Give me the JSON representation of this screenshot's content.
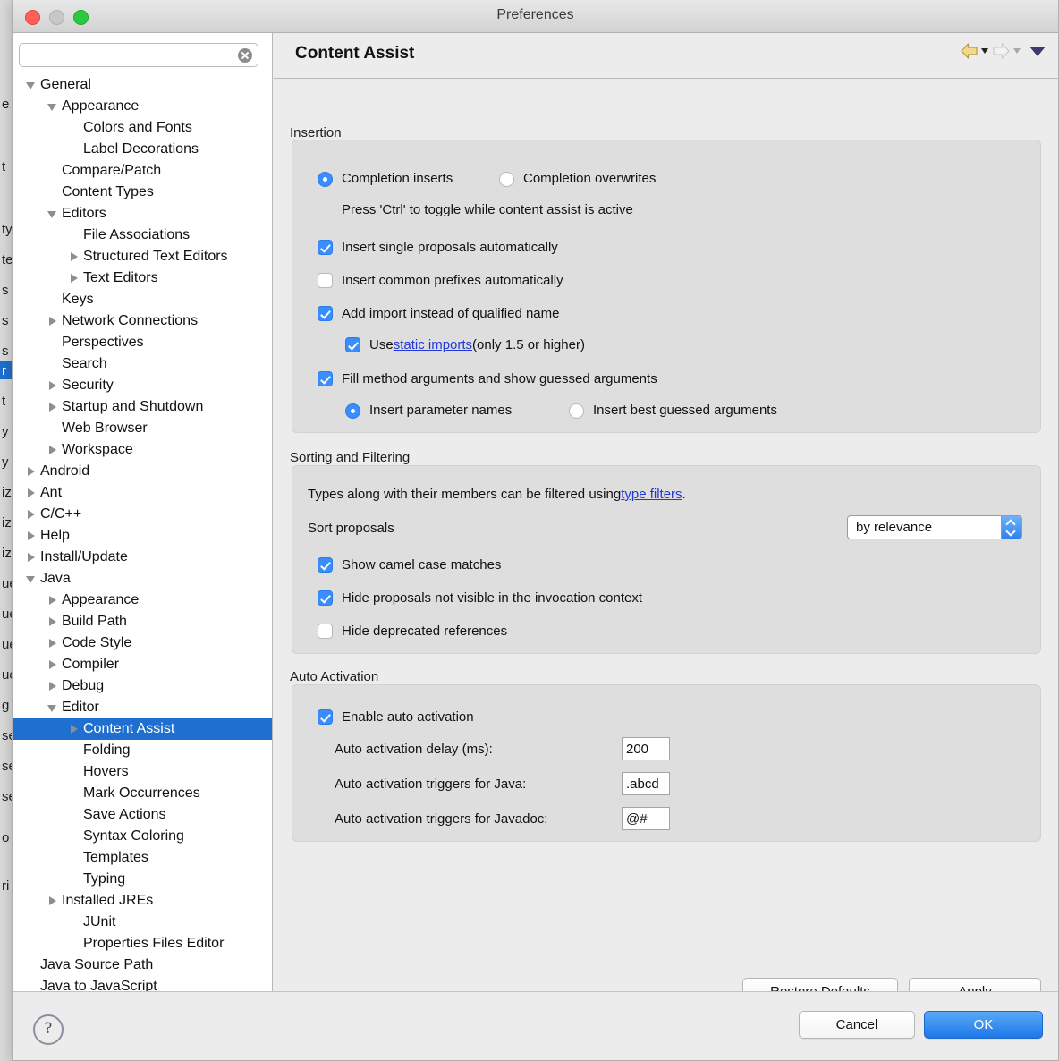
{
  "window": {
    "title": "Preferences",
    "traffic": {
      "close": "close-button",
      "minimize": "minimize-button",
      "zoom": "zoom-button"
    }
  },
  "sidebar": {
    "search": {
      "value": "",
      "placeholder": ""
    },
    "tree": [
      {
        "label": "General",
        "depth": 0,
        "twisty": "expanded",
        "selected": false
      },
      {
        "label": "Appearance",
        "depth": 1,
        "twisty": "expanded",
        "selected": false
      },
      {
        "label": "Colors and Fonts",
        "depth": 2,
        "twisty": "none",
        "selected": false
      },
      {
        "label": "Label Decorations",
        "depth": 2,
        "twisty": "none",
        "selected": false
      },
      {
        "label": "Compare/Patch",
        "depth": 1,
        "twisty": "none",
        "selected": false
      },
      {
        "label": "Content Types",
        "depth": 1,
        "twisty": "none",
        "selected": false
      },
      {
        "label": "Editors",
        "depth": 1,
        "twisty": "expanded",
        "selected": false
      },
      {
        "label": "File Associations",
        "depth": 2,
        "twisty": "none",
        "selected": false
      },
      {
        "label": "Structured Text Editors",
        "depth": 2,
        "twisty": "collapsed",
        "selected": false
      },
      {
        "label": "Text Editors",
        "depth": 2,
        "twisty": "collapsed",
        "selected": false
      },
      {
        "label": "Keys",
        "depth": 1,
        "twisty": "none",
        "selected": false
      },
      {
        "label": "Network Connections",
        "depth": 1,
        "twisty": "collapsed",
        "selected": false
      },
      {
        "label": "Perspectives",
        "depth": 1,
        "twisty": "none",
        "selected": false
      },
      {
        "label": "Search",
        "depth": 1,
        "twisty": "none",
        "selected": false
      },
      {
        "label": "Security",
        "depth": 1,
        "twisty": "collapsed",
        "selected": false
      },
      {
        "label": "Startup and Shutdown",
        "depth": 1,
        "twisty": "collapsed",
        "selected": false
      },
      {
        "label": "Web Browser",
        "depth": 1,
        "twisty": "none",
        "selected": false
      },
      {
        "label": "Workspace",
        "depth": 1,
        "twisty": "collapsed",
        "selected": false
      },
      {
        "label": "Android",
        "depth": 0,
        "twisty": "collapsed",
        "selected": false
      },
      {
        "label": "Ant",
        "depth": 0,
        "twisty": "collapsed",
        "selected": false
      },
      {
        "label": "C/C++",
        "depth": 0,
        "twisty": "collapsed",
        "selected": false
      },
      {
        "label": "Help",
        "depth": 0,
        "twisty": "collapsed",
        "selected": false
      },
      {
        "label": "Install/Update",
        "depth": 0,
        "twisty": "collapsed",
        "selected": false
      },
      {
        "label": "Java",
        "depth": 0,
        "twisty": "expanded",
        "selected": false
      },
      {
        "label": "Appearance",
        "depth": 1,
        "twisty": "collapsed",
        "selected": false
      },
      {
        "label": "Build Path",
        "depth": 1,
        "twisty": "collapsed",
        "selected": false
      },
      {
        "label": "Code Style",
        "depth": 1,
        "twisty": "collapsed",
        "selected": false
      },
      {
        "label": "Compiler",
        "depth": 1,
        "twisty": "collapsed",
        "selected": false
      },
      {
        "label": "Debug",
        "depth": 1,
        "twisty": "collapsed",
        "selected": false
      },
      {
        "label": "Editor",
        "depth": 1,
        "twisty": "expanded",
        "selected": false
      },
      {
        "label": "Content Assist",
        "depth": 2,
        "twisty": "collapsed",
        "selected": true
      },
      {
        "label": "Folding",
        "depth": 2,
        "twisty": "none",
        "selected": false
      },
      {
        "label": "Hovers",
        "depth": 2,
        "twisty": "none",
        "selected": false
      },
      {
        "label": "Mark Occurrences",
        "depth": 2,
        "twisty": "none",
        "selected": false
      },
      {
        "label": "Save Actions",
        "depth": 2,
        "twisty": "none",
        "selected": false
      },
      {
        "label": "Syntax Coloring",
        "depth": 2,
        "twisty": "none",
        "selected": false
      },
      {
        "label": "Templates",
        "depth": 2,
        "twisty": "none",
        "selected": false
      },
      {
        "label": "Typing",
        "depth": 2,
        "twisty": "none",
        "selected": false
      },
      {
        "label": "Installed JREs",
        "depth": 1,
        "twisty": "collapsed",
        "selected": false
      },
      {
        "label": "JUnit",
        "depth": 2,
        "twisty": "none",
        "selected": false
      },
      {
        "label": "Properties Files Editor",
        "depth": 2,
        "twisty": "none",
        "selected": false
      },
      {
        "label": "Java Source Path",
        "depth": 0,
        "twisty": "none",
        "selected": false
      },
      {
        "label": "Java to JavaScript",
        "depth": 0,
        "twisty": "none",
        "selected": false
      }
    ]
  },
  "page": {
    "title": "Content Assist",
    "nav": {
      "back_icon": "back-arrow-icon",
      "forward_icon": "forward-arrow-icon",
      "menu_icon": "view-menu-triangle-icon"
    }
  },
  "insertion": {
    "group_label": "Insertion",
    "radio_inserts": "Completion inserts",
    "radio_overwrites": "Completion overwrites",
    "hint": "Press 'Ctrl' to toggle while content assist is active",
    "cb_single_proposals": "Insert single proposals automatically",
    "cb_common_prefixes": "Insert common prefixes automatically",
    "cb_add_import": "Add import instead of qualified name",
    "static_prefix": "Use ",
    "static_link": "static imports",
    "static_suffix": " (only 1.5 or higher)",
    "cb_fill_method": "Fill method arguments and show guessed arguments",
    "radio_param_names": "Insert parameter names",
    "radio_best_guessed": "Insert best guessed arguments"
  },
  "sorting": {
    "group_label": "Sorting and Filtering",
    "filter_prefix": "Types along with their members can be filtered using ",
    "filter_link": "type filters",
    "filter_suffix": ".",
    "sort_label": "Sort proposals",
    "sort_value": "by relevance",
    "cb_camel_case": "Show camel case matches",
    "cb_hide_not_visible": "Hide proposals not visible in the invocation context",
    "cb_hide_deprecated": "Hide deprecated references"
  },
  "auto_activation": {
    "group_label": "Auto Activation",
    "cb_enable": "Enable auto activation",
    "delay_label": "Auto activation delay (ms):",
    "delay_value": "200",
    "java_label": "Auto activation triggers for Java:",
    "java_value": ".abcd",
    "javadoc_label": "Auto activation triggers for Javadoc:",
    "javadoc_value": "@#"
  },
  "actions": {
    "restore_defaults": "Restore Defaults",
    "apply": "Apply",
    "cancel": "Cancel",
    "ok": "OK",
    "help": "?"
  },
  "colors": {
    "selection_blue": "#1f6fd0",
    "control_blue": "#3a8dfd",
    "link_blue": "#2338d8",
    "primary_button": "#1d78e8"
  }
}
